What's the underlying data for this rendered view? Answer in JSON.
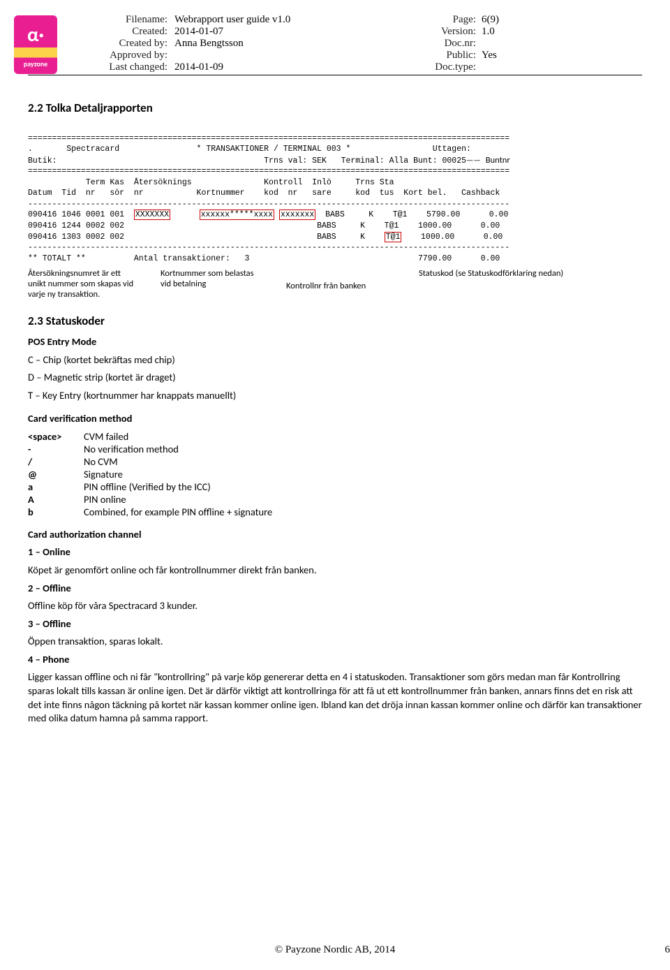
{
  "header": {
    "labels": {
      "filename": "Filename:",
      "created": "Created:",
      "createdby": "Created by:",
      "approvedby": "Approved by:",
      "lastchanged": "Last changed:",
      "page": "Page:",
      "version": "Version:",
      "docnr": "Doc.nr:",
      "public": "Public:",
      "doctype": "Doc.type:"
    },
    "values": {
      "filename": "Webrapport user guide v1.0",
      "created": "2014-01-07",
      "createdby": "Anna Bengtsson",
      "approvedby": "",
      "lastchanged": "2014-01-09",
      "page": "6(9)",
      "version": "1.0",
      "docnr": "",
      "public": "Yes",
      "doctype": ""
    },
    "logo_text": "payzone"
  },
  "section22_title": "2.2  Tolka Detaljrapporten",
  "report": {
    "sep": "====================================================================================================",
    "header1": ".       Spectracard                * TRANSAKTIONER / TERMINAL 003 *                 Uttagen:",
    "header2": "Butik:                                           Trns val: SEK   Terminal: Alla Bunt: 00025",
    "colhead1": "            Term Kas  Återsöknings               Kontroll  Inlö     Trns Sta",
    "colhead2": "Datum  Tid  nr   sör  nr           Kortnummer    kod  nr   sare     kod  tus  Kort bel.   Cashback",
    "dash": "----------------------------------------------------------------------------------------------------",
    "row1a": "090416 1046 0001 001  ",
    "row1b_box": "XXXXXXX",
    "row1c": "      ",
    "row1d_box": "xxxxxx*****xxxx",
    "row1e": " ",
    "row1f_box": "xxxxxxx",
    "row1g": "  BABS     K    T@1    5790.00      0.00",
    "row2": "090416 1244 0002 002                                        BABS     K    T@1    1000.00      0.00",
    "row3a": "090416 1303 0002 002                                        BABS     K    ",
    "row3b_box": "T@1",
    "row3c": "    1000.00      0.00",
    "total": "** TOTALT **          Antal transaktioner:   3                                   7790.00      0.00",
    "buntnr_label": "Buntnr",
    "annot1": "Återsökningsnumret är ett unikt nummer som skapas vid varje ny transaktion.",
    "annot2": "Kortnummer som belastas vid betalning",
    "annot3": "Kontrollnr från banken",
    "annot4": "Statuskod (se Statuskodförklaring nedan)"
  },
  "section23_title": "2.3  Statuskoder",
  "pos_title": "POS Entry Mode",
  "pos_c": "C – Chip (kortet bekräftas med chip)",
  "pos_d": "D – Magnetic strip (kortet är draget)",
  "pos_t": "T – Key Entry (kortnummer har knappats manuellt)",
  "cvm_title": "Card verification method",
  "cvm": [
    {
      "k": "<space>",
      "v": "CVM failed"
    },
    {
      "k": "-",
      "v": "No verification method"
    },
    {
      "k": "/",
      "v": "No CVM"
    },
    {
      "k": "@",
      "v": "Signature"
    },
    {
      "k": "a",
      "v": "PIN offline (Verified by the ICC)"
    },
    {
      "k": "A",
      "v": "PIN online"
    },
    {
      "k": "b",
      "v": "Combined, for example PIN offline + signature"
    }
  ],
  "cac_title": "Card authorization channel",
  "cac1_h": "1 – Online",
  "cac1_t": "Köpet är genomfört online och får kontrollnummer direkt från banken.",
  "cac2_h": "2 – Offline",
  "cac2_t": "Offline köp för våra Spectracard 3 kunder.",
  "cac3_h": "3 – Offline",
  "cac3_t": "Öppen transaktion, sparas lokalt.",
  "cac4_h": "4 – Phone",
  "cac4_t": "Ligger kassan offline och ni får \"kontrollring\" på varje köp genererar detta en 4 i statuskoden. Transaktioner som görs medan man får Kontrollring sparas lokalt tills kassan är online igen. Det är därför viktigt att kontrollringa för att få ut ett kontrollnummer från banken, annars finns det en risk att det inte finns någon täckning på kortet när kassan kommer online igen. Ibland kan det dröja innan kassan kommer online och därför kan transaktioner med olika datum hamna på samma rapport.",
  "footer": "© Payzone Nordic AB, 2014",
  "footer_page": "6"
}
